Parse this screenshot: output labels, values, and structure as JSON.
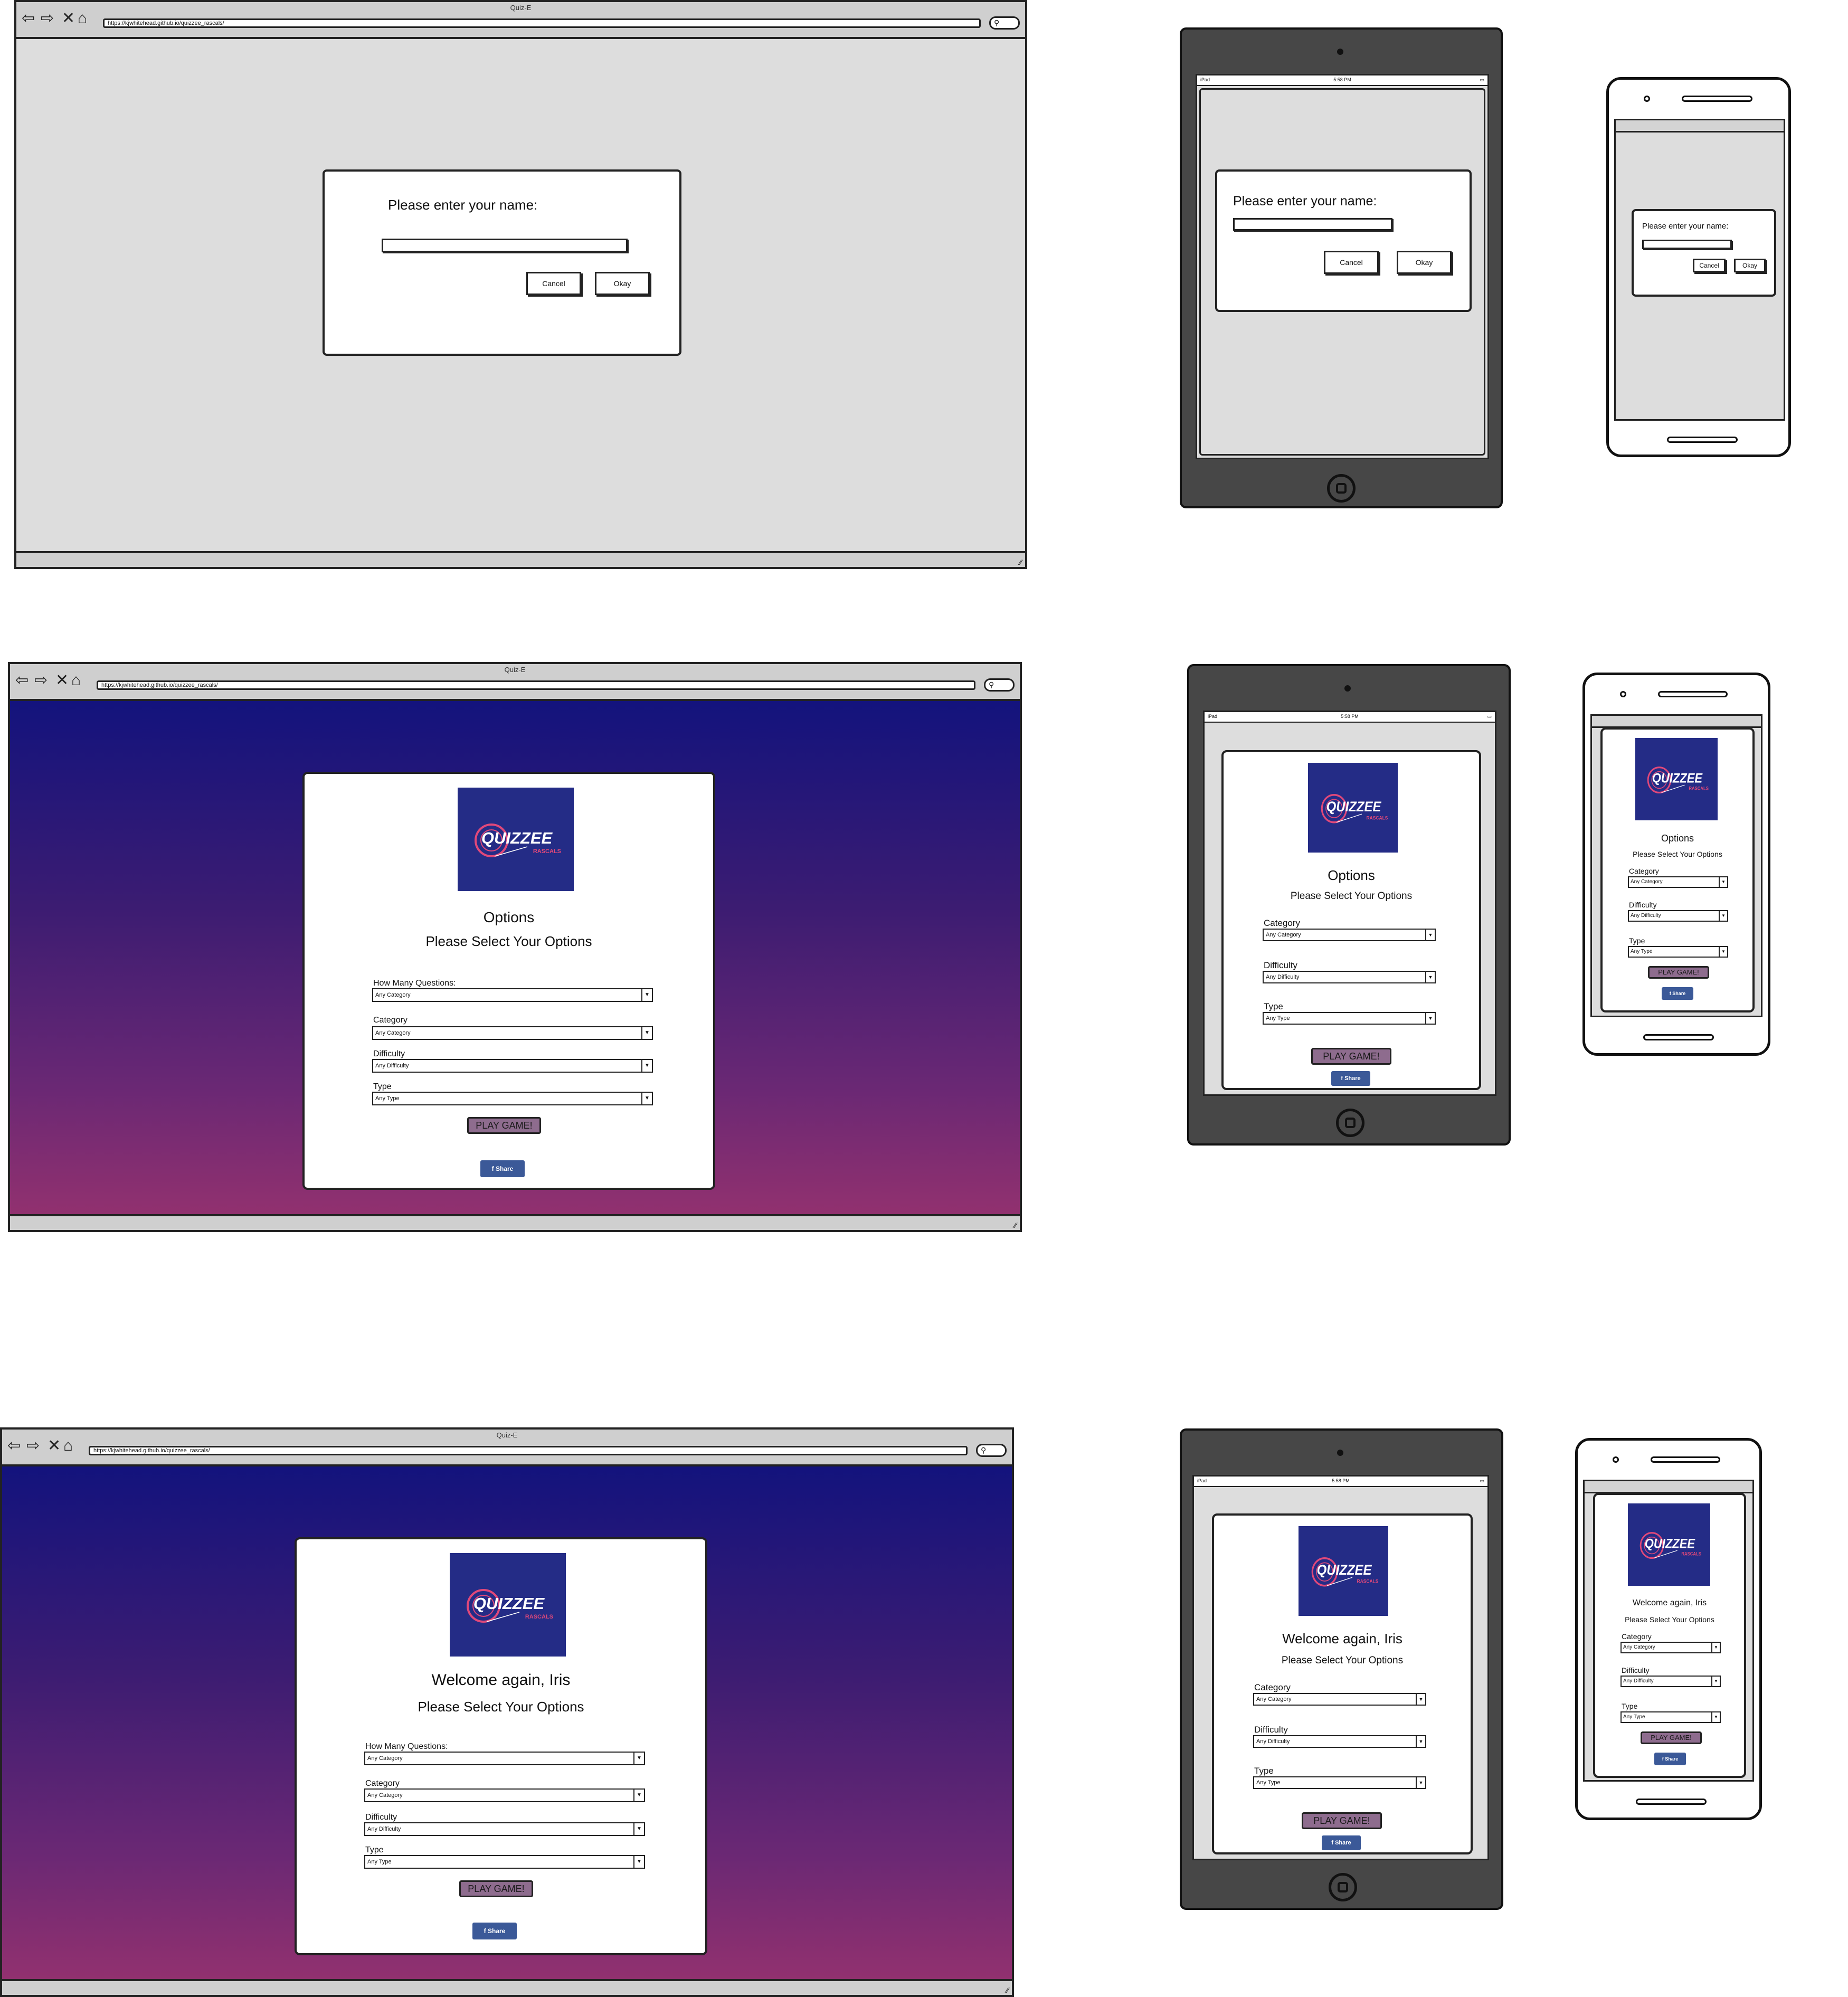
{
  "browser": {
    "title": "Quiz-E",
    "url": "https://kjwhitehead.github.io/quizzee_rascals/"
  },
  "name_prompt": {
    "message": "Please enter your name:",
    "cancel_label": "Cancel",
    "ok_label": "Okay"
  },
  "options_screen": {
    "heading": "Options",
    "welcome_heading": "Welcome again, Iris",
    "subheading": "Please Select Your Options",
    "fields": {
      "how_many_label": "How Many Questions:",
      "how_many_value": "Any Category",
      "category_label": "Category",
      "category_value": "Any Category",
      "difficulty_label": "Difficulty",
      "difficulty_value": "Any Difficulty",
      "type_label": "Type",
      "type_value": "Any Type"
    },
    "play_label": "PLAY GAME!",
    "share_label": "Share"
  },
  "logo": {
    "main": "QUIZZEE",
    "sub": "RASCALS",
    "bg_color": "#242c86",
    "accent_color": "#e0487a"
  },
  "tablet_status": {
    "carrier": "iPad",
    "time": "5:58 PM"
  },
  "theme": {
    "gradient_top": "#13137d",
    "gradient_bottom": "#92316f",
    "play_color": "#8e6c8e",
    "facebook_color": "#3b5998"
  }
}
